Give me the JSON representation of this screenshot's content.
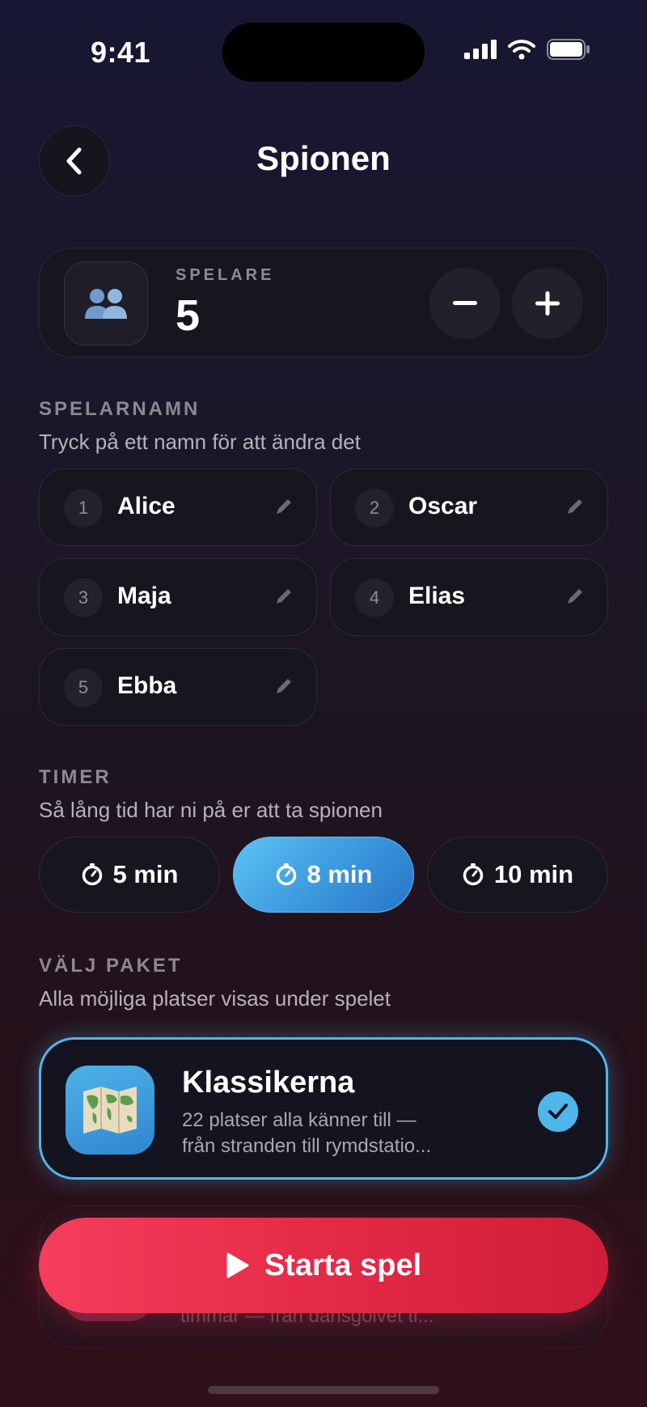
{
  "status_bar": {
    "time": "9:41"
  },
  "header": {
    "title": "Spionen"
  },
  "players": {
    "label": "SPELARE",
    "count": "5"
  },
  "player_names": {
    "label": "SPELARNAMN",
    "subtitle": "Tryck på ett namn för att ändra det",
    "players": [
      {
        "num": "1",
        "name": "Alice"
      },
      {
        "num": "2",
        "name": "Oscar"
      },
      {
        "num": "3",
        "name": "Maja"
      },
      {
        "num": "4",
        "name": "Elias"
      },
      {
        "num": "5",
        "name": "Ebba"
      }
    ]
  },
  "timer": {
    "label": "TIMER",
    "subtitle": "Så lång tid har ni på er att ta spionen",
    "options": [
      "5 min",
      "8 min",
      "10 min"
    ],
    "selected": "8 min"
  },
  "packs": {
    "label": "VÄLJ PAKET",
    "subtitle": "Alla möjliga platser visas under spelet",
    "selected_pack": {
      "title": "Klassikerna",
      "description_line1": "22 platser alla känner till —",
      "description_line2": "från stranden till rymdstatio..."
    },
    "hidden_pack_partial": "timmar — från dansgolvet ti..."
  },
  "start_button": {
    "label": "Starta spel"
  },
  "colors": {
    "accent_blue": "#4fb6ea",
    "start_red": "#e42a46"
  }
}
